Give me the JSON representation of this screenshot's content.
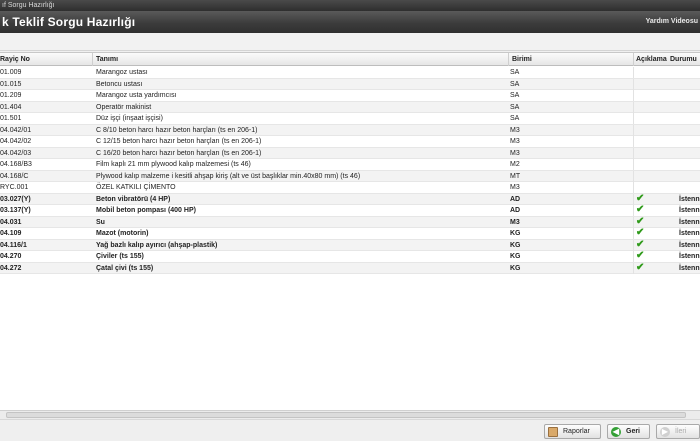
{
  "window": {
    "title": "ıf Sorgu Hazırlığı"
  },
  "header": {
    "title": "k Teklif Sorgu Hazırlığı",
    "help": "Yardım Videosu"
  },
  "table": {
    "columns": [
      "Rayiç No",
      "Tanımı",
      "Birimi",
      "Açıklama",
      "Durumu"
    ],
    "rows": [
      {
        "code": "01.009",
        "name": "Marangoz ustası",
        "unit": "SA",
        "checked": false,
        "state": "",
        "bold": false
      },
      {
        "code": "01.015",
        "name": "Betoncu ustası",
        "unit": "SA",
        "checked": false,
        "state": "",
        "bold": false
      },
      {
        "code": "01.209",
        "name": "Marangoz usta yardımcısı",
        "unit": "SA",
        "checked": false,
        "state": "",
        "bold": false
      },
      {
        "code": "01.404",
        "name": "Operatör makinist",
        "unit": "SA",
        "checked": false,
        "state": "",
        "bold": false
      },
      {
        "code": "01.501",
        "name": "Düz işçi (inşaat işçisi)",
        "unit": "SA",
        "checked": false,
        "state": "",
        "bold": false
      },
      {
        "code": "04.042/01",
        "name": "C 8/10 beton harcı hazır beton harçları (ts en 206-1)",
        "unit": "M3",
        "checked": false,
        "state": "",
        "bold": false
      },
      {
        "code": "04.042/02",
        "name": "C 12/15 beton harcı hazır beton harçları (ts en 206-1)",
        "unit": "M3",
        "checked": false,
        "state": "",
        "bold": false
      },
      {
        "code": "04.042/03",
        "name": "C 16/20 beton harcı hazır beton harçları (ts en 206-1)",
        "unit": "M3",
        "checked": false,
        "state": "",
        "bold": false
      },
      {
        "code": "04.168/B3",
        "name": "Film kaplı 21 mm plywood kalıp malzemesi (ts 46)",
        "unit": "M2",
        "checked": false,
        "state": "",
        "bold": false
      },
      {
        "code": "04.168/C",
        "name": "Plywood kalıp malzeme i kesitli ahşap kiriş (alt ve üst başlıklar min.40x80 mm) (ts 46)",
        "unit": "MT",
        "checked": false,
        "state": "",
        "bold": false
      },
      {
        "code": "RYC.001",
        "name": "ÖZEL KATKILI ÇİMENTO",
        "unit": "M3",
        "checked": false,
        "state": "",
        "bold": false
      },
      {
        "code": "03.027(Y)",
        "name": "Beton vibratörü (4 HP)",
        "unit": "AD",
        "checked": true,
        "state": "İstenn",
        "bold": true
      },
      {
        "code": "03.137(Y)",
        "name": "Mobil beton pompası (400 HP)",
        "unit": "AD",
        "checked": true,
        "state": "İstenn",
        "bold": true
      },
      {
        "code": "04.031",
        "name": "Su",
        "unit": "M3",
        "checked": true,
        "state": "İstenn",
        "bold": true
      },
      {
        "code": "04.109",
        "name": "Mazot (motorin)",
        "unit": "KG",
        "checked": true,
        "state": "İstenn",
        "bold": true
      },
      {
        "code": "04.116/1",
        "name": "Yağ bazlı kalıp ayırıcı (ahşap-plastik)",
        "unit": "KG",
        "checked": true,
        "state": "İstenn",
        "bold": true
      },
      {
        "code": "04.270",
        "name": "Çiviler (ts 155)",
        "unit": "KG",
        "checked": true,
        "state": "İstenn",
        "bold": true
      },
      {
        "code": "04.272",
        "name": "Çatal çivi (ts 155)",
        "unit": "KG",
        "checked": true,
        "state": "İstenn",
        "bold": true
      }
    ]
  },
  "footer": {
    "reports_label": "Raporlar",
    "back_label": "Geri",
    "next_label": "İleri"
  },
  "colors": {
    "check": "#2f9a1a",
    "header_bg": "#3c3c3c"
  }
}
